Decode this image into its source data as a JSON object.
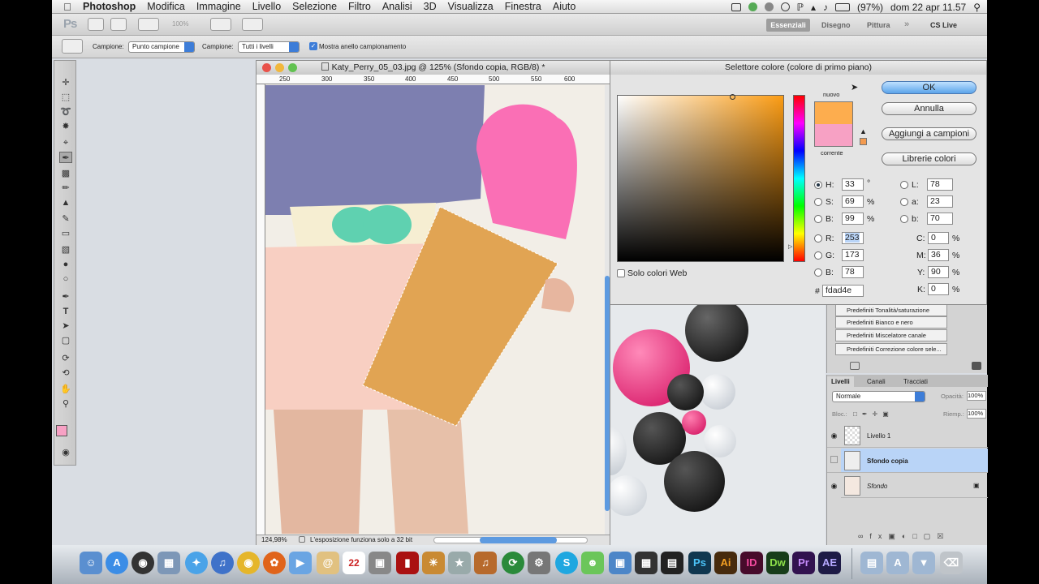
{
  "menubar": {
    "app": "Photoshop",
    "menus": [
      "Modifica",
      "Immagine",
      "Livello",
      "Selezione",
      "Filtro",
      "Analisi",
      "3D",
      "Visualizza",
      "Finestra",
      "Aiuto"
    ],
    "battery": "(97%)",
    "datetime": "dom 22 apr  11.57"
  },
  "psbar": {
    "logo": "Ps",
    "zoom": "100%",
    "workspaces": [
      "Essenziali",
      "Disegno",
      "Pittura"
    ],
    "cslive": "CS Live"
  },
  "options": {
    "sample_label": "Campione:",
    "sample_value": "Punto campione",
    "sample2_label": "Campione:",
    "sample2_value": "Tutti i livelli",
    "ring_label": "Mostra anello campionamento"
  },
  "document": {
    "title": "Katy_Perry_05_03.jpg @ 125% (Sfondo copia, RGB/8) *",
    "ruler_ticks": [
      "250",
      "300",
      "350",
      "400",
      "450",
      "500",
      "550",
      "600"
    ],
    "zoom": "124,98%",
    "status": "L'esposizione funziona solo a 32 bit"
  },
  "picker": {
    "title": "Selettore colore (colore di primo piano)",
    "new_label": "nuovo",
    "current_label": "corrente",
    "ok": "OK",
    "cancel": "Annulla",
    "add_swatches": "Aggiungi a campioni",
    "libraries": "Librerie colori",
    "web_only": "Solo colori Web",
    "new_color": "#fdad4e",
    "current_color": "#f7a1c4",
    "hsb": [
      {
        "label": "H:",
        "value": "33",
        "unit": "°"
      },
      {
        "label": "S:",
        "value": "69",
        "unit": "%"
      },
      {
        "label": "B:",
        "value": "99",
        "unit": "%"
      }
    ],
    "rgb": [
      {
        "label": "R:",
        "value": "253"
      },
      {
        "label": "G:",
        "value": "173"
      },
      {
        "label": "B:",
        "value": "78"
      }
    ],
    "lab": [
      {
        "label": "L:",
        "value": "78"
      },
      {
        "label": "a:",
        "value": "23"
      },
      {
        "label": "b:",
        "value": "70"
      }
    ],
    "cmyk": [
      {
        "label": "C:",
        "value": "0",
        "unit": "%"
      },
      {
        "label": "M:",
        "value": "36",
        "unit": "%"
      },
      {
        "label": "Y:",
        "value": "90",
        "unit": "%"
      },
      {
        "label": "K:",
        "value": "0",
        "unit": "%"
      }
    ],
    "hex_label": "#",
    "hex": "fdad4e"
  },
  "presets": {
    "items": [
      "Predefiniti Tonalità/saturazione",
      "Predefiniti Bianco e nero",
      "Predefiniti Miscelatore canale",
      "Predefiniti Correzione colore sele..."
    ]
  },
  "layers": {
    "tabs": [
      "Livelli",
      "Canali",
      "Tracciati"
    ],
    "blend": "Normale",
    "opacity_label": "Opacità:",
    "opacity": "100%",
    "lock_label": "Bloc.:",
    "fill_label": "Riemp.:",
    "fill": "100%",
    "items": [
      {
        "name": "Livello 1"
      },
      {
        "name": "Sfondo copia"
      },
      {
        "name": "Sfondo"
      }
    ]
  },
  "dock": {
    "calendar_day": "22",
    "apps": [
      "Ps",
      "Ai",
      "ID",
      "Dw",
      "Pr",
      "AE"
    ]
  }
}
